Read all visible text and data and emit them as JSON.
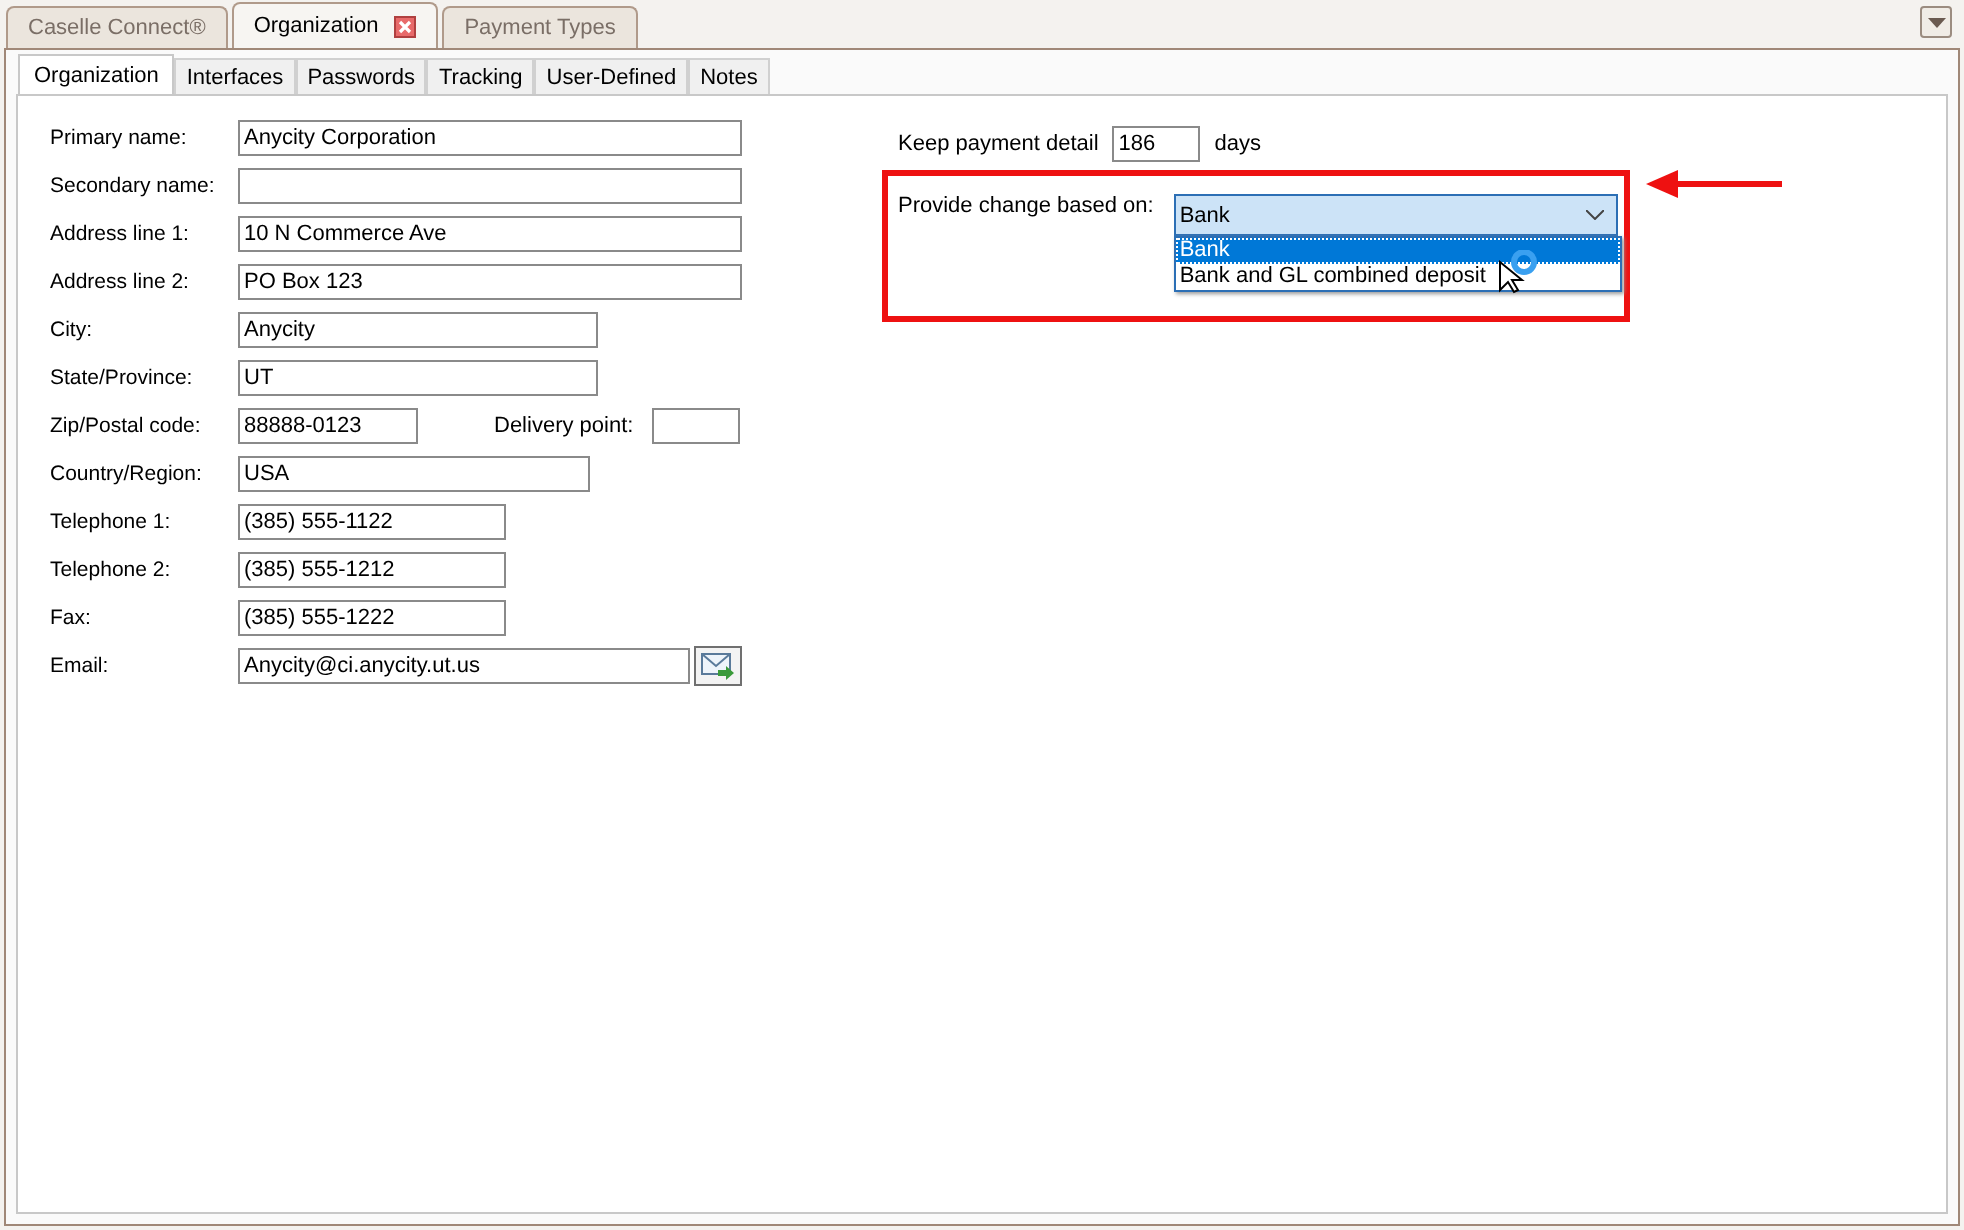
{
  "document_tabs": [
    {
      "label": "Caselle Connect®",
      "selected": false,
      "closable": false
    },
    {
      "label": "Organization",
      "selected": true,
      "closable": true
    },
    {
      "label": "Payment Types",
      "selected": false,
      "closable": false
    }
  ],
  "tabs": [
    {
      "label": "Organization",
      "selected": true
    },
    {
      "label": "Interfaces",
      "selected": false
    },
    {
      "label": "Passwords",
      "selected": false
    },
    {
      "label": "Tracking",
      "selected": false
    },
    {
      "label": "User-Defined",
      "selected": false
    },
    {
      "label": "Notes",
      "selected": false
    }
  ],
  "fields": [
    {
      "kind": "text",
      "label": "Primary name:",
      "value": "Anycity Corporation"
    },
    {
      "kind": "text",
      "label": "Secondary name:"
    },
    {
      "kind": "text",
      "label": "Address line 1:",
      "value": "10 N Commerce Ave"
    },
    {
      "kind": "text",
      "label": "Address line 2:",
      "value": "PO Box 123"
    },
    {
      "kind": "text",
      "label": "City:",
      "value": "Anycity"
    },
    {
      "kind": "text",
      "label": "State/Province:",
      "value": "UT"
    },
    {
      "kind": "with_extra",
      "label": "Zip/Postal code:",
      "value": "88888-0123",
      "extra_label": "Delivery point:"
    },
    {
      "kind": "text",
      "label": "Country/Region:",
      "value": "USA"
    },
    {
      "kind": "text",
      "label": "Telephone 1:",
      "value": "(385) 555-1122"
    },
    {
      "kind": "text",
      "label": "Telephone 2:",
      "value": "(385) 555-1212"
    },
    {
      "kind": "text",
      "label": "Fax:",
      "value": "(385) 555-1222"
    },
    {
      "kind": "email",
      "label": "Email:",
      "value": "Anycity@ci.anycity.ut.us"
    }
  ],
  "keep_payment": {
    "label": "Keep payment detail",
    "value": "186",
    "unit": "days"
  },
  "change_based_on": {
    "label": "Provide change based on:",
    "value": "Bank",
    "expanded": true,
    "options": [
      {
        "label": "Bank",
        "selected": true
      },
      {
        "label": "Bank and GL combined deposit",
        "selected": false
      }
    ]
  }
}
